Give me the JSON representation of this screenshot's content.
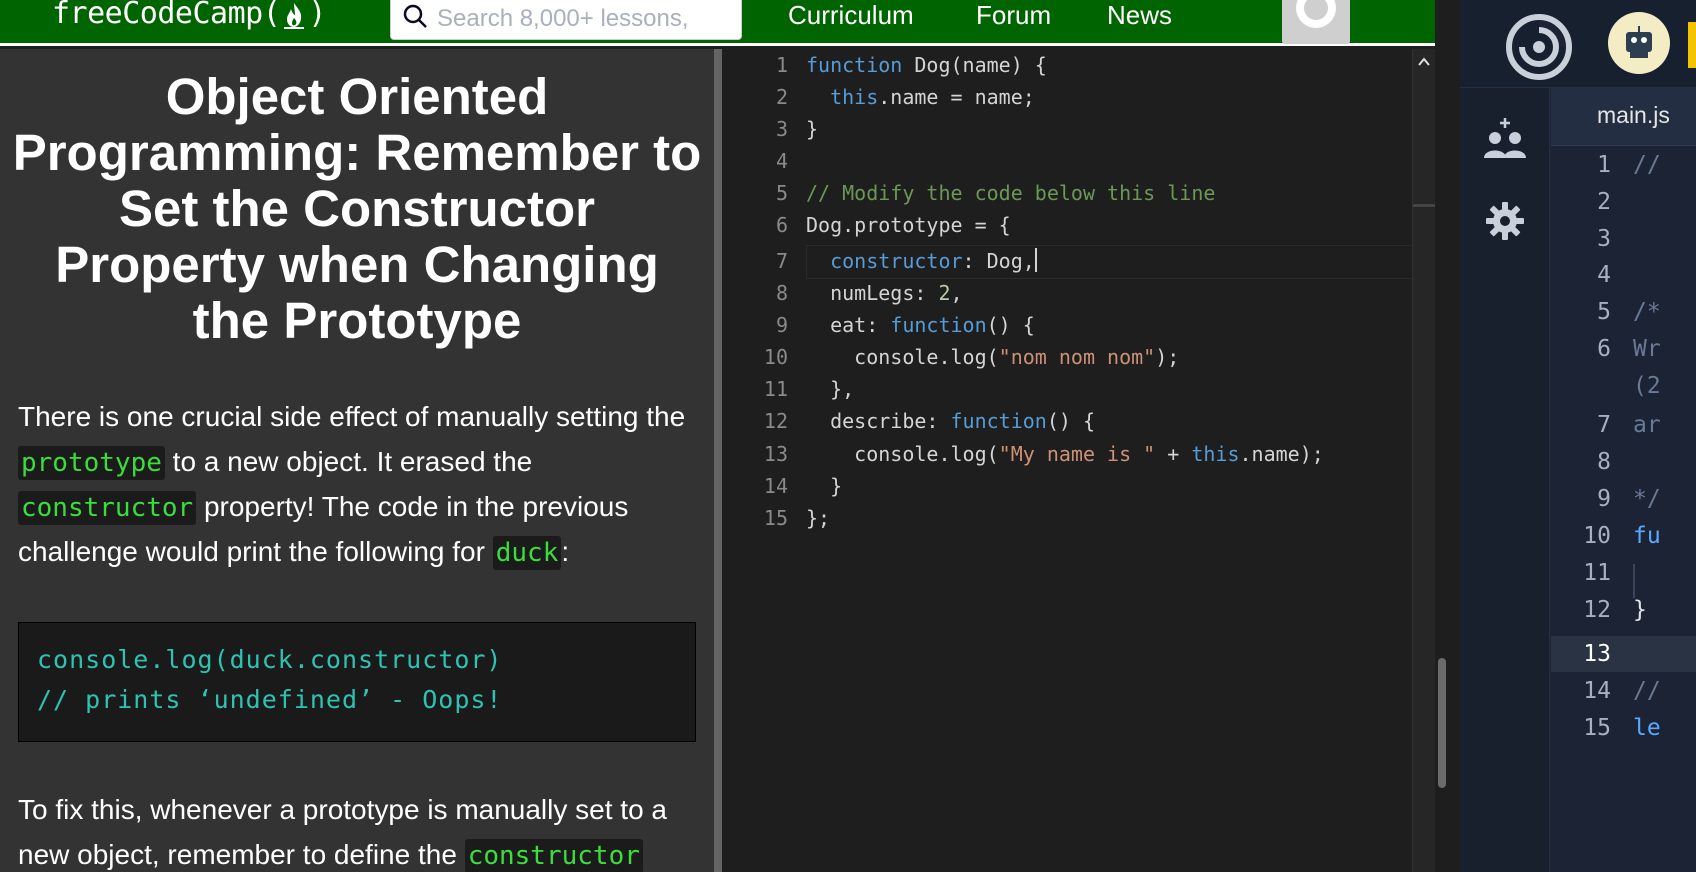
{
  "nav": {
    "logo_text": "freeCodeCamp(",
    "logo_close": ")",
    "search_placeholder": "Search 8,000+ lessons,",
    "links": [
      "Curriculum",
      "Forum",
      "News"
    ]
  },
  "lesson": {
    "title": "Object Oriented Programming: Remember to Set the Constructor Property when Changing the Prototype",
    "para1": {
      "t1": "There is one crucial side effect of manually setting the ",
      "c1": "prototype",
      "t2": " to a new object. It erased the ",
      "c2": "constructor",
      "t3": " property! The code in the previous challenge would print the following for ",
      "c3": "duck",
      "t4": ":"
    },
    "code_block": [
      "console.log(duck.constructor)",
      "// prints ‘undefined’ - Oops!"
    ],
    "para2": {
      "t1": "To fix this, whenever a prototype is manually set to a new object, remember to define the ",
      "c1": "constructor"
    }
  },
  "editor": {
    "line_numbers": [
      "1",
      "2",
      "3",
      "4",
      "5",
      "6",
      "7",
      "8",
      "9",
      "10",
      "11",
      "12",
      "13",
      "14",
      "15"
    ],
    "active_line": 7
  },
  "ide": {
    "tab_label": "main.js",
    "line_numbers": [
      "1",
      "2",
      "3",
      "4",
      "5",
      "6",
      "",
      "7",
      "8",
      "9",
      "10",
      "11",
      "12",
      "13",
      "14",
      "15"
    ],
    "lines": [
      "//",
      "",
      "",
      "",
      "/*",
      "Wr",
      "(2",
      "ar",
      "",
      "*/",
      "fu",
      "",
      "}",
      "",
      "//",
      "le"
    ],
    "active_line": "13"
  },
  "colors": {
    "nav_green": "#006400",
    "lesson_bg": "#333333",
    "inline_code": "#3bdd3b",
    "code_block_text": "#2dc3b3",
    "editor_bg": "#1e1e1e",
    "ide_bg": "#1b2334"
  }
}
